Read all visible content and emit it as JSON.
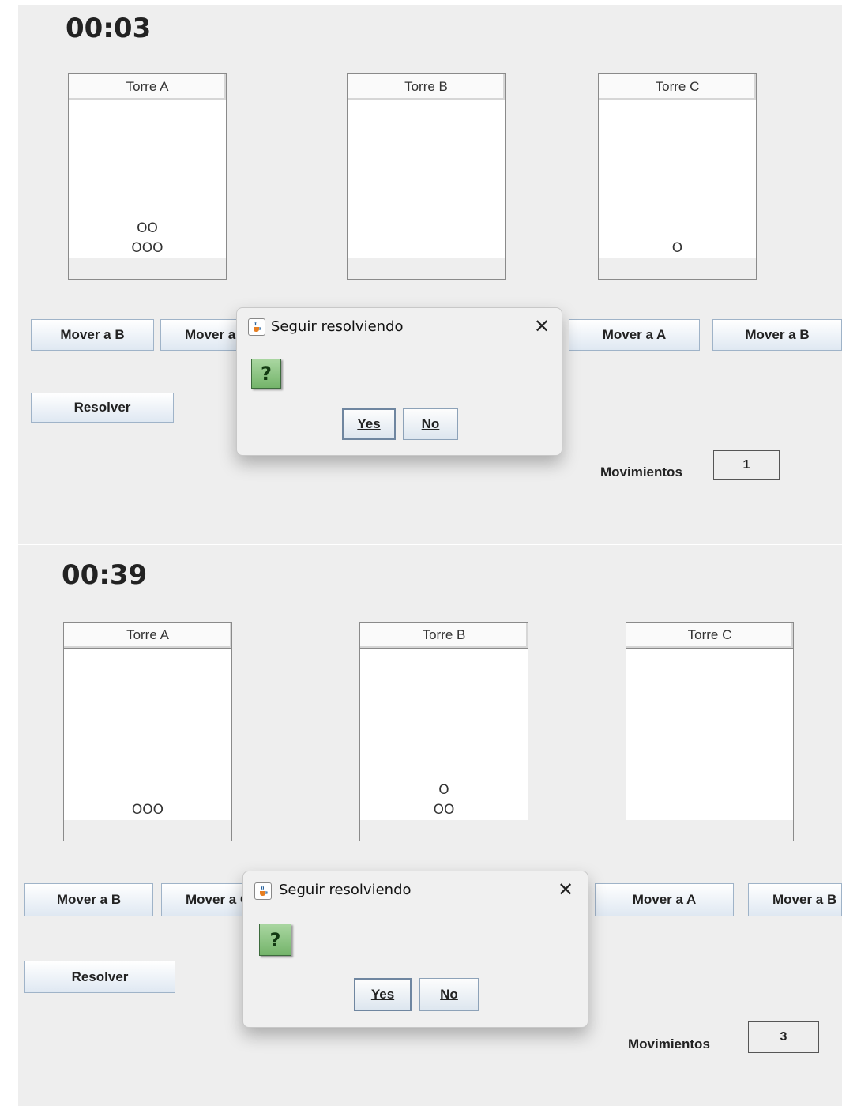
{
  "window1": {
    "timer": "00:03",
    "towers": [
      {
        "label": "Torre A",
        "disks": [
          "OO",
          "OOO"
        ]
      },
      {
        "label": "Torre B",
        "disks": []
      },
      {
        "label": "Torre C",
        "disks": [
          "O"
        ]
      }
    ],
    "buttons": {
      "a_to_b": "Mover a B",
      "a_to_c": "Mover a C",
      "c_to_a": "Mover a A",
      "c_to_b": "Mover a B",
      "resolver": "Resolver"
    },
    "moves_label": "Movimientos",
    "moves_count": "1",
    "dialog": {
      "title": "Seguir resolviendo",
      "close": "✕",
      "question_icon": "?",
      "yes": "Yes",
      "no": "No"
    }
  },
  "window2": {
    "timer": "00:39",
    "towers": [
      {
        "label": "Torre A",
        "disks": [
          "OOO"
        ]
      },
      {
        "label": "Torre B",
        "disks": [
          "O",
          "OO"
        ]
      },
      {
        "label": "Torre C",
        "disks": []
      }
    ],
    "buttons": {
      "a_to_b": "Mover a B",
      "a_to_c": "Mover a C",
      "c_to_a": "Mover a A",
      "c_to_b": "Mover a B",
      "resolver": "Resolver"
    },
    "moves_label": "Movimientos",
    "moves_count": "3",
    "dialog": {
      "title": "Seguir resolviendo",
      "close": "✕",
      "question_icon": "?",
      "yes": "Yes",
      "no": "No"
    }
  },
  "icons": {
    "java": "java-cup-icon",
    "question": "question-icon",
    "close": "close-icon"
  }
}
